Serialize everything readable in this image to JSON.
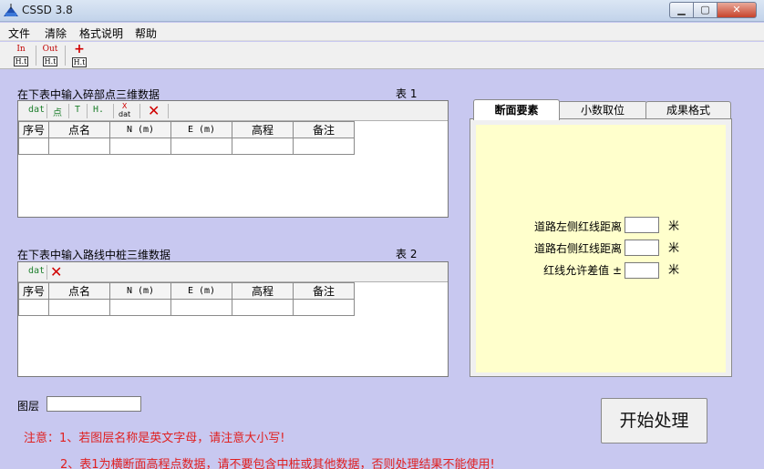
{
  "window": {
    "title": "CSSD 3.8",
    "min": "▁",
    "max": "▢",
    "close": "✕"
  },
  "menu": [
    "文件",
    "清除",
    "格式说明",
    "帮助"
  ],
  "toolbar": {
    "in_top": "In",
    "in_bot": "H.t",
    "out_top": "Out",
    "out_bot": "H.t",
    "plus_top": "+",
    "plus_bot": "H.t"
  },
  "table1": {
    "caption": "在下表中输入碎部点三维数据",
    "name": "表 1",
    "tools": {
      "dat": "dat",
      "pt": "点",
      "t": "T",
      "h": "H.",
      "xdat_top": "X",
      "xdat_bot": "dat"
    },
    "headers": [
      "序号",
      "点名",
      "N (m)",
      "E (m)",
      "高程",
      "备注"
    ]
  },
  "table2": {
    "caption": "在下表中输入路线中桩三维数据",
    "name": "表 2",
    "tools": {
      "dat": "dat"
    },
    "headers": [
      "序号",
      "点名",
      "N (m)",
      "E (m)",
      "高程",
      "备注"
    ]
  },
  "tabs": [
    "断面要素",
    "小数取位",
    "成果格式"
  ],
  "fields": [
    {
      "label": "道路左侧红线距离",
      "unit": "米"
    },
    {
      "label": "道路右侧红线距离",
      "unit": "米"
    },
    {
      "label": "红线允许差值 ±",
      "unit": "米"
    }
  ],
  "layer_label": "图层",
  "start_button": "开始处理",
  "notes": [
    "注意：1、若图层名称是英文字母，请注意大小写!",
    "2、表1为横断面高程点数据，请不要包含中桩或其他数据，否则处理结果不能使用!"
  ],
  "colors": {
    "background": "#c8c8f0",
    "panel": "#ffffcc",
    "warning": "#e02020"
  }
}
